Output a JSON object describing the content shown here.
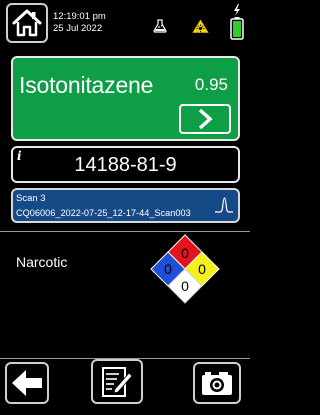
{
  "status_bar": {
    "time": "12:19:01 pm",
    "date": "25 Jul 2022",
    "icons": [
      "home-icon",
      "flask-icon",
      "laser-warning-icon",
      "battery-charging-icon"
    ]
  },
  "result": {
    "compound": "Isotonitazene",
    "score": "0.95",
    "next_icon": "chevron-right-icon",
    "color": "#0d9e46"
  },
  "identifier": {
    "info_glyph": "i",
    "cas_number": "14188-81-9"
  },
  "scan": {
    "title": "Scan 3",
    "filename": "CQ06006_2022-07-25_12-17-44_Scan003",
    "icon": "spectrum-icon",
    "color": "#164a86"
  },
  "hazard": {
    "classification": "Narcotic",
    "nfpa": {
      "health": "0",
      "flammability": "0",
      "instability": "0",
      "special": "0",
      "colors": {
        "health": "#1f4fd6",
        "flammability": "#e3141c",
        "instability": "#f6ef1e",
        "special": "#ffffff"
      }
    }
  },
  "toolbar": {
    "back_icon": "arrow-left-icon",
    "notes_icon": "notes-edit-icon",
    "camera_icon": "camera-icon"
  }
}
